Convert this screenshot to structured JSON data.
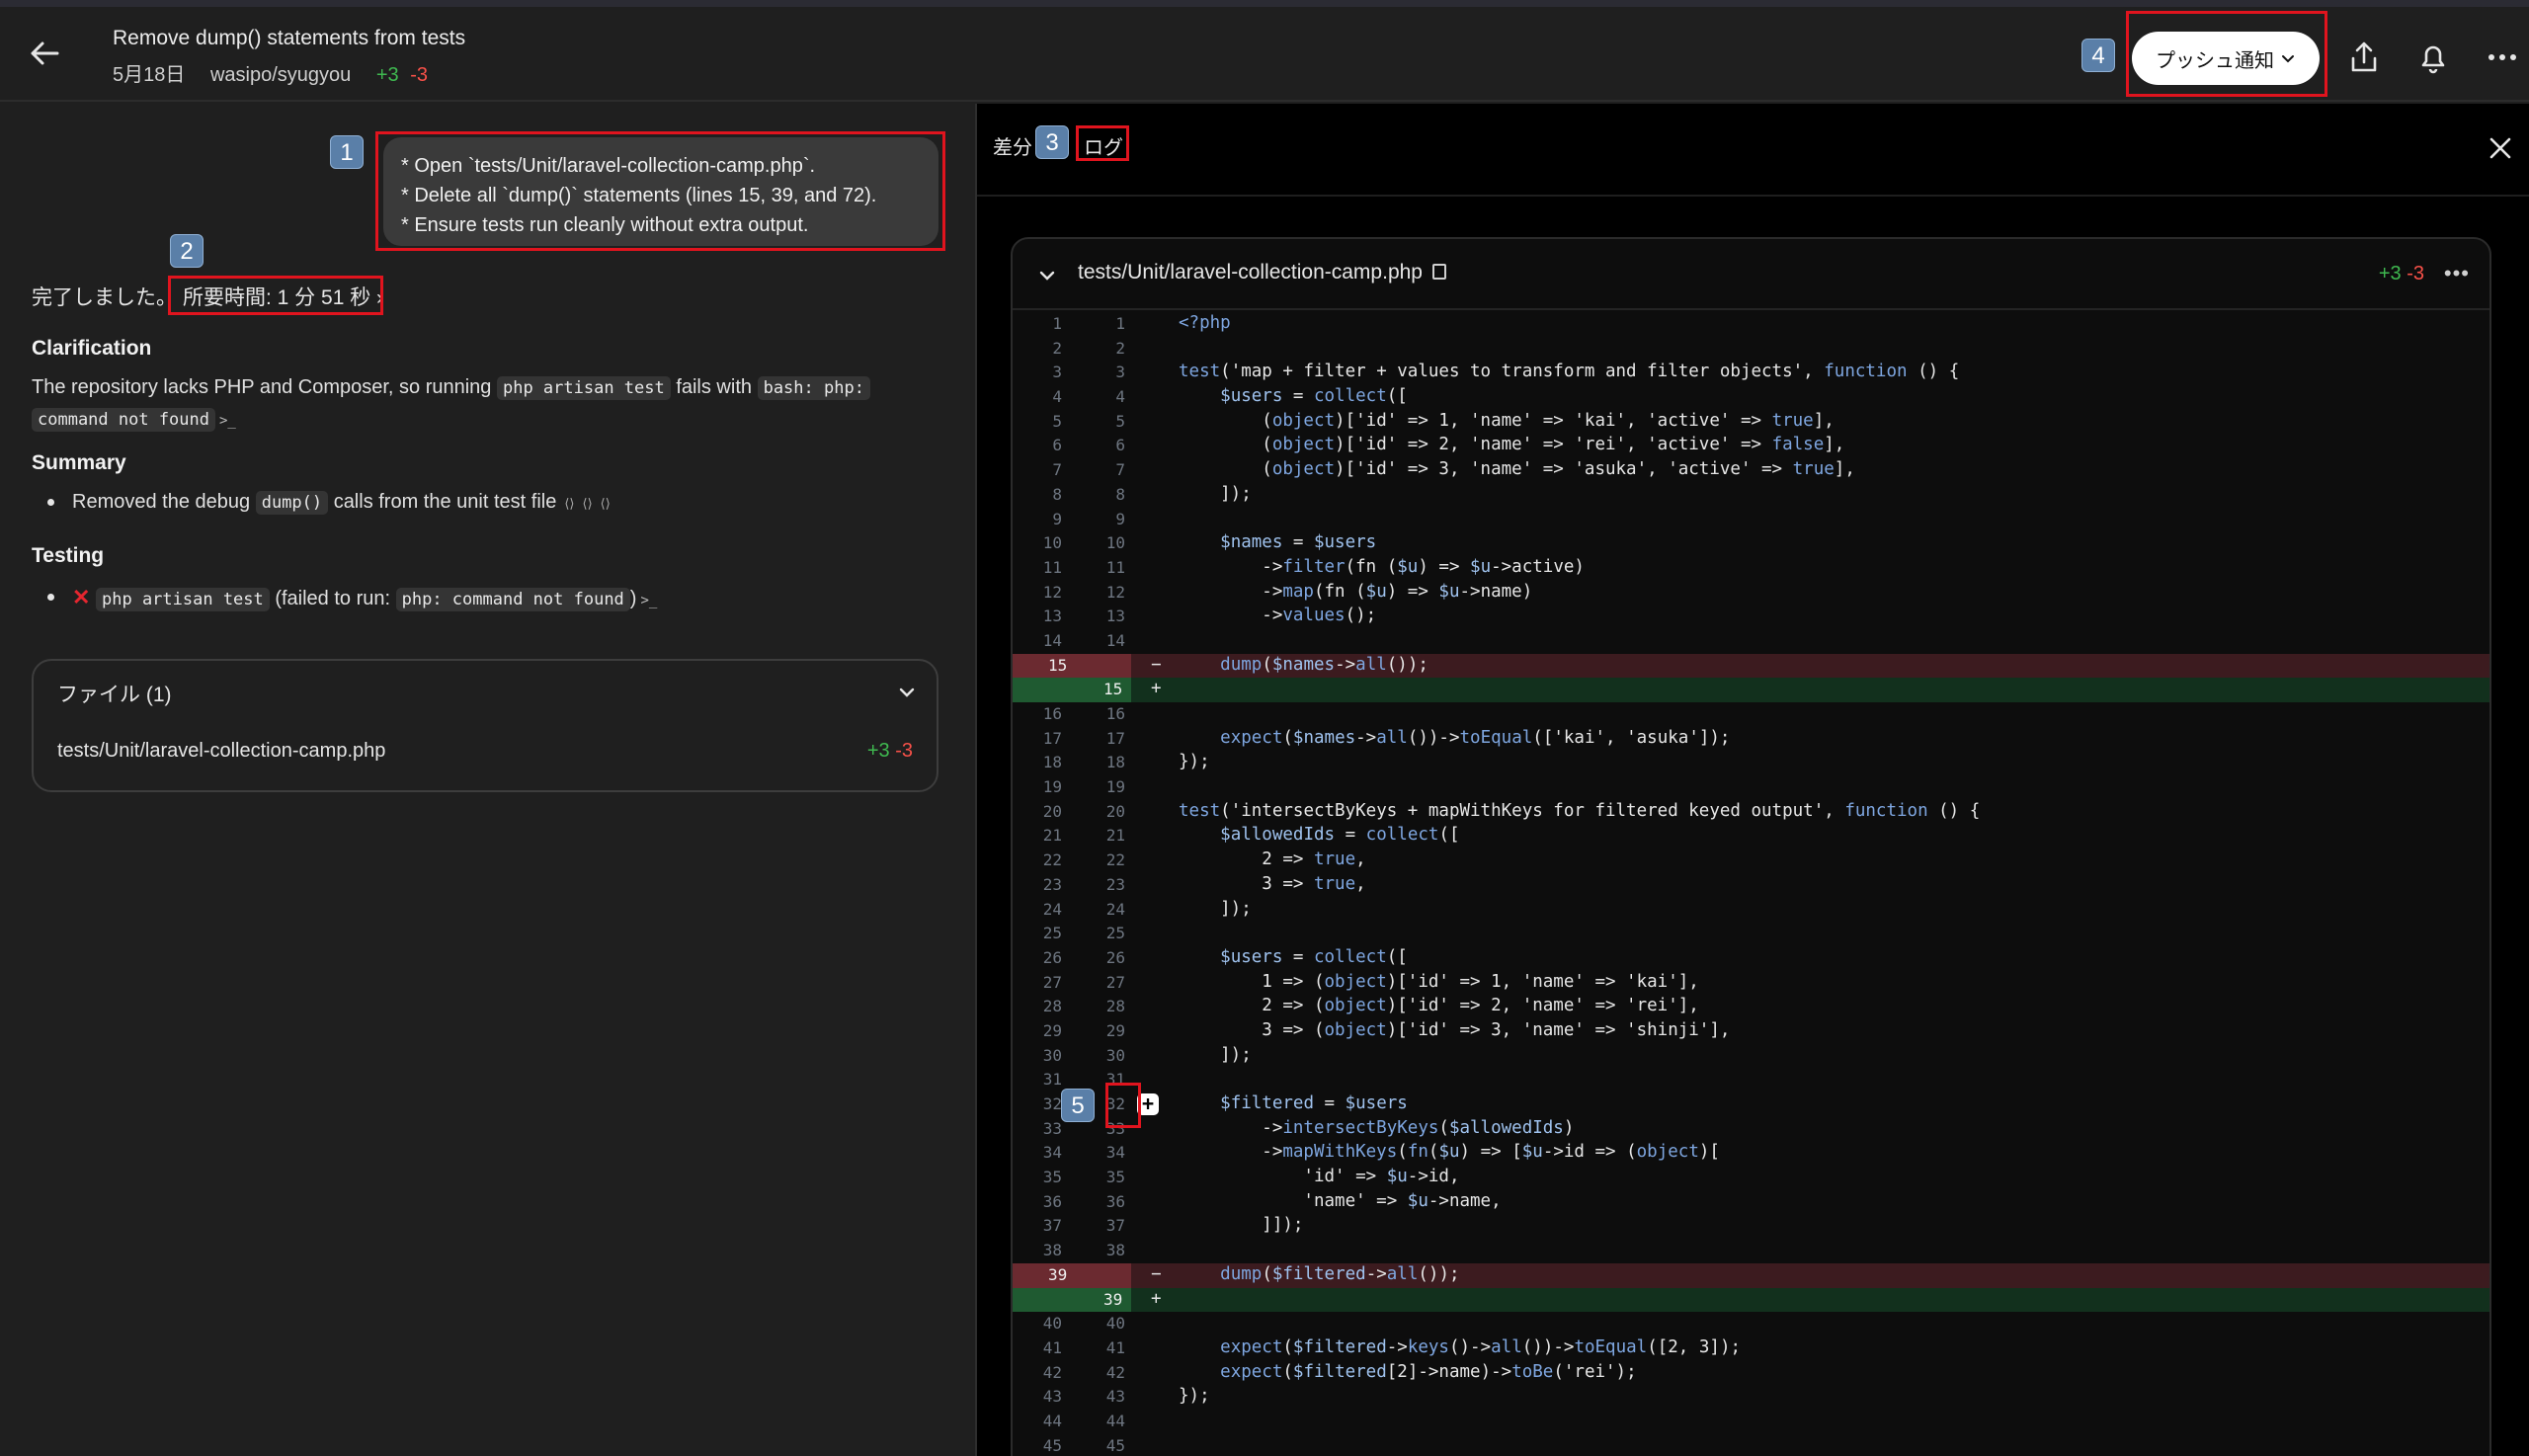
{
  "header": {
    "title": "Remove dump() statements from tests",
    "date": "5月18日",
    "repo": "wasipo/syugyou",
    "additions": "+3",
    "deletions": "-3",
    "push_button": "プッシュ通知",
    "icons": [
      "arrow-left-icon",
      "share-icon",
      "bell-icon",
      "more-icon"
    ]
  },
  "badges": {
    "b1": "1",
    "b2": "2",
    "b3": "3",
    "b4": "4",
    "b5": "5"
  },
  "left": {
    "prompt_lines": [
      "* Open `tests/Unit/laravel-collection-camp.php`.",
      "* Delete all `dump()` statements (lines 15, 39, and 72).",
      "* Ensure tests run cleanly without extra output."
    ],
    "done_text": "完了しました。",
    "duration": "所要時間: 1 分 51 秒",
    "clarification_heading": "Clarification",
    "clarification_pre": "The repository lacks PHP and Composer, so running",
    "clarification_code1": "php artisan test",
    "clarification_mid": "fails with",
    "clarification_code2": "bash: php:",
    "clarification_code3": "command not found",
    "summary_heading": "Summary",
    "summary_pre": "Removed the debug",
    "summary_code": "dump()",
    "summary_post": "calls from the unit test file",
    "testing_heading": "Testing",
    "testing_code": "php artisan test",
    "testing_mid": "(failed to run:",
    "testing_code2": "php: command not found",
    "testing_post": ")",
    "files_heading": "ファイル (1)",
    "file_path": "tests/Unit/laravel-collection-camp.php",
    "file_add": "+3",
    "file_del": "-3"
  },
  "right": {
    "tab_diff": "差分",
    "tab_log": "ログ",
    "file_path": "tests/Unit/laravel-collection-camp.php",
    "additions": "+3",
    "deletions": "-3"
  },
  "diff_lines": [
    {
      "o": "1",
      "n": "1",
      "t": "ctx",
      "c": "<?php"
    },
    {
      "o": "2",
      "n": "2",
      "t": "ctx",
      "c": ""
    },
    {
      "o": "3",
      "n": "3",
      "t": "ctx",
      "c": "test('map + filter + values to transform and filter objects', function () {"
    },
    {
      "o": "4",
      "n": "4",
      "t": "ctx",
      "c": "    $users = collect(["
    },
    {
      "o": "5",
      "n": "5",
      "t": "ctx",
      "c": "        (object)['id' => 1, 'name' => 'kai', 'active' => true],"
    },
    {
      "o": "6",
      "n": "6",
      "t": "ctx",
      "c": "        (object)['id' => 2, 'name' => 'rei', 'active' => false],"
    },
    {
      "o": "7",
      "n": "7",
      "t": "ctx",
      "c": "        (object)['id' => 3, 'name' => 'asuka', 'active' => true],"
    },
    {
      "o": "8",
      "n": "8",
      "t": "ctx",
      "c": "    ]);"
    },
    {
      "o": "9",
      "n": "9",
      "t": "ctx",
      "c": ""
    },
    {
      "o": "10",
      "n": "10",
      "t": "ctx",
      "c": "    $names = $users"
    },
    {
      "o": "11",
      "n": "11",
      "t": "ctx",
      "c": "        ->filter(fn ($u) => $u->active)"
    },
    {
      "o": "12",
      "n": "12",
      "t": "ctx",
      "c": "        ->map(fn ($u) => $u->name)"
    },
    {
      "o": "13",
      "n": "13",
      "t": "ctx",
      "c": "        ->values();"
    },
    {
      "o": "14",
      "n": "14",
      "t": "ctx",
      "c": ""
    },
    {
      "o": "15",
      "n": "",
      "t": "del",
      "c": "    dump($names->all());"
    },
    {
      "o": "",
      "n": "15",
      "t": "add",
      "c": ""
    },
    {
      "o": "16",
      "n": "16",
      "t": "ctx",
      "c": ""
    },
    {
      "o": "17",
      "n": "17",
      "t": "ctx",
      "c": "    expect($names->all())->toEqual(['kai', 'asuka']);"
    },
    {
      "o": "18",
      "n": "18",
      "t": "ctx",
      "c": "});"
    },
    {
      "o": "19",
      "n": "19",
      "t": "ctx",
      "c": ""
    },
    {
      "o": "20",
      "n": "20",
      "t": "ctx",
      "c": "test('intersectByKeys + mapWithKeys for filtered keyed output', function () {"
    },
    {
      "o": "21",
      "n": "21",
      "t": "ctx",
      "c": "    $allowedIds = collect(["
    },
    {
      "o": "22",
      "n": "22",
      "t": "ctx",
      "c": "        2 => true,"
    },
    {
      "o": "23",
      "n": "23",
      "t": "ctx",
      "c": "        3 => true,"
    },
    {
      "o": "24",
      "n": "24",
      "t": "ctx",
      "c": "    ]);"
    },
    {
      "o": "25",
      "n": "25",
      "t": "ctx",
      "c": ""
    },
    {
      "o": "26",
      "n": "26",
      "t": "ctx",
      "c": "    $users = collect(["
    },
    {
      "o": "27",
      "n": "27",
      "t": "ctx",
      "c": "        1 => (object)['id' => 1, 'name' => 'kai'],"
    },
    {
      "o": "28",
      "n": "28",
      "t": "ctx",
      "c": "        2 => (object)['id' => 2, 'name' => 'rei'],"
    },
    {
      "o": "29",
      "n": "29",
      "t": "ctx",
      "c": "        3 => (object)['id' => 3, 'name' => 'shinji'],"
    },
    {
      "o": "30",
      "n": "30",
      "t": "ctx",
      "c": "    ]);"
    },
    {
      "o": "31",
      "n": "31",
      "t": "ctx",
      "c": ""
    },
    {
      "o": "32",
      "n": "32",
      "t": "ctx",
      "c": "    $filtered = $users",
      "plus": true
    },
    {
      "o": "33",
      "n": "33",
      "t": "ctx",
      "c": "        ->intersectByKeys($allowedIds)"
    },
    {
      "o": "34",
      "n": "34",
      "t": "ctx",
      "c": "        ->mapWithKeys(fn($u) => [$u->id => (object)["
    },
    {
      "o": "35",
      "n": "35",
      "t": "ctx",
      "c": "            'id' => $u->id,"
    },
    {
      "o": "36",
      "n": "36",
      "t": "ctx",
      "c": "            'name' => $u->name,"
    },
    {
      "o": "37",
      "n": "37",
      "t": "ctx",
      "c": "        ]]);"
    },
    {
      "o": "38",
      "n": "38",
      "t": "ctx",
      "c": ""
    },
    {
      "o": "39",
      "n": "",
      "t": "del",
      "c": "    dump($filtered->all());"
    },
    {
      "o": "",
      "n": "39",
      "t": "add",
      "c": ""
    },
    {
      "o": "40",
      "n": "40",
      "t": "ctx",
      "c": ""
    },
    {
      "o": "41",
      "n": "41",
      "t": "ctx",
      "c": "    expect($filtered->keys()->all())->toEqual([2, 3]);"
    },
    {
      "o": "42",
      "n": "42",
      "t": "ctx",
      "c": "    expect($filtered[2]->name)->toBe('rei');"
    },
    {
      "o": "43",
      "n": "43",
      "t": "ctx",
      "c": "});"
    },
    {
      "o": "44",
      "n": "44",
      "t": "ctx",
      "c": ""
    },
    {
      "o": "45",
      "n": "45",
      "t": "ctx",
      "c": ""
    }
  ]
}
